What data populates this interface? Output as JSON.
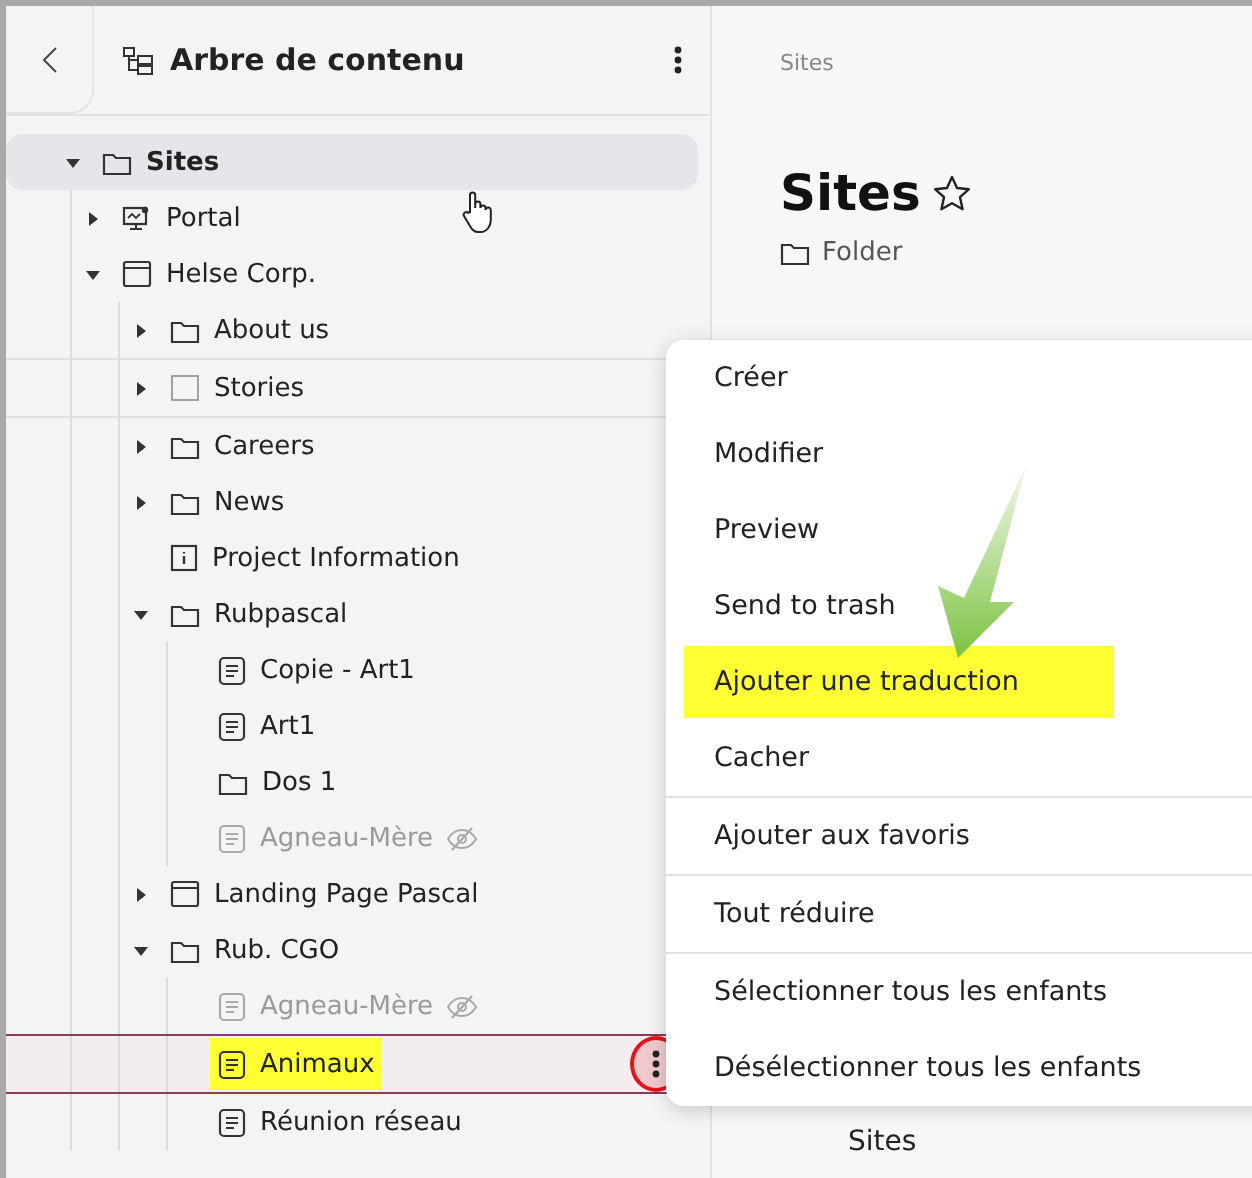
{
  "panel": {
    "title": "Arbre de contenu"
  },
  "tree": [
    {
      "label": "Sites",
      "kind": "folder",
      "expanded": true,
      "selected": true,
      "children": [
        {
          "label": "Portal",
          "kind": "portal",
          "expanded": false
        },
        {
          "label": "Helse Corp.",
          "kind": "page",
          "expanded": true,
          "children": [
            {
              "label": "About us",
              "kind": "folder",
              "expanded": false
            },
            {
              "label": "Stories",
              "kind": "blank",
              "expanded": false,
              "hovered": true
            },
            {
              "label": "Careers",
              "kind": "folder",
              "expanded": false
            },
            {
              "label": "News",
              "kind": "folder",
              "expanded": false
            },
            {
              "label": "Project Information",
              "kind": "info"
            },
            {
              "label": "Rubpascal",
              "kind": "folder",
              "expanded": true,
              "children": [
                {
                  "label": "Copie - Art1",
                  "kind": "article"
                },
                {
                  "label": "Art1",
                  "kind": "article"
                },
                {
                  "label": "Dos 1",
                  "kind": "folder"
                },
                {
                  "label": "Agneau-Mère",
                  "kind": "article",
                  "hidden": true
                }
              ]
            },
            {
              "label": "Landing Page Pascal",
              "kind": "page",
              "expanded": false
            },
            {
              "label": "Rub. CGO",
              "kind": "folder",
              "expanded": true,
              "children": [
                {
                  "label": "Agneau-Mère",
                  "kind": "article",
                  "hidden": true
                },
                {
                  "label": "Animaux",
                  "kind": "article",
                  "highlighted": true
                },
                {
                  "label": "Réunion réseau",
                  "kind": "article"
                }
              ]
            }
          ]
        }
      ]
    }
  ],
  "content": {
    "breadcrumb": "Sites",
    "title": "Sites",
    "type": "Folder",
    "footer_label": "Sites"
  },
  "menu": {
    "groups": [
      [
        {
          "label": "Créer",
          "highlighted": false
        },
        {
          "label": "Modifier",
          "highlighted": false
        },
        {
          "label": "Preview",
          "highlighted": false
        },
        {
          "label": "Send to trash",
          "highlighted": false
        },
        {
          "label": "Ajouter une traduction",
          "highlighted": true
        },
        {
          "label": "Cacher",
          "highlighted": false
        }
      ],
      [
        {
          "label": "Ajouter aux favoris",
          "highlighted": false
        }
      ],
      [
        {
          "label": "Tout réduire",
          "highlighted": false
        }
      ],
      [
        {
          "label": "Sélectionner tous les enfants",
          "highlighted": false
        },
        {
          "label": "Désélectionner tous les enfants",
          "highlighted": false
        }
      ]
    ]
  }
}
